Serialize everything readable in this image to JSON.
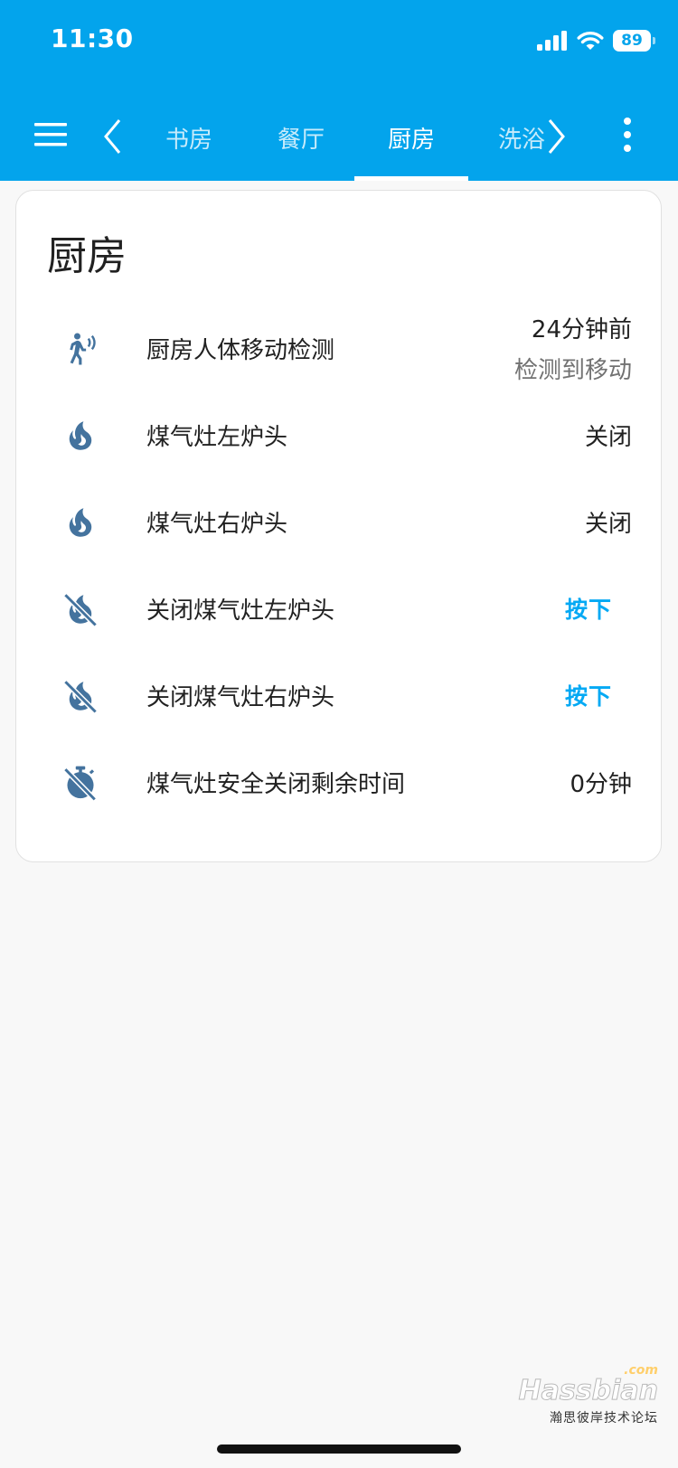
{
  "status_bar": {
    "time": "11:30",
    "battery": "89",
    "icons": [
      "signal-icon",
      "wifi-icon",
      "battery-icon"
    ]
  },
  "toolbar": {
    "menu_icon": "menu-icon",
    "more_icon": "more-vert-icon",
    "scroll_left_icon": "chevron-left-icon",
    "scroll_right_icon": "chevron-right-icon",
    "tabs": [
      {
        "label": "书房"
      },
      {
        "label": "餐厅"
      },
      {
        "label": "厨房",
        "active": true
      },
      {
        "label": "洗浴"
      }
    ]
  },
  "card": {
    "title": "厨房",
    "rows": [
      {
        "icon": "motion-sensor-icon",
        "name": "厨房人体移动检测",
        "value": "24分钟前",
        "sub_value": "检测到移动"
      },
      {
        "icon": "fire-icon",
        "name": "煤气灶左炉头",
        "value": "关闭"
      },
      {
        "icon": "fire-icon",
        "name": "煤气灶右炉头",
        "value": "关闭"
      },
      {
        "icon": "fire-off-icon",
        "name": "关闭煤气灶左炉头",
        "button": "按下"
      },
      {
        "icon": "fire-off-icon",
        "name": "关闭煤气灶右炉头",
        "button": "按下"
      },
      {
        "icon": "timer-off-icon",
        "name": "煤气灶安全关闭剩余时间",
        "value": "0分钟"
      }
    ]
  },
  "watermark": {
    "com": ".com",
    "brand": "Hassbian",
    "slogan": "瀚思彼岸技术论坛"
  },
  "colors": {
    "header": "#03a4ec",
    "accent_button": "#03a9f4",
    "icon": "#44739e",
    "background": "#f8f8f8"
  }
}
